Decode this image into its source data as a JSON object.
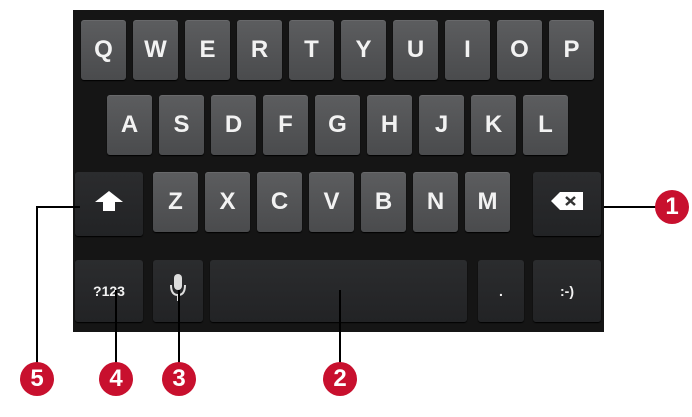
{
  "keyboard": {
    "row1": [
      "Q",
      "W",
      "E",
      "R",
      "T",
      "Y",
      "U",
      "I",
      "O",
      "P"
    ],
    "row2": [
      "A",
      "S",
      "D",
      "F",
      "G",
      "H",
      "J",
      "K",
      "L"
    ],
    "row3": [
      "Z",
      "X",
      "C",
      "V",
      "B",
      "N",
      "M"
    ],
    "bottom": {
      "symbols_label": "?123",
      "period_label": ".",
      "smiley_label": ":-)"
    },
    "icons": {
      "shift": "shift-arrow-icon",
      "delete": "backspace-icon",
      "voice": "microphone-icon"
    }
  },
  "callouts": [
    "1",
    "2",
    "3",
    "4",
    "5"
  ],
  "colors": {
    "callout_badge": "#c8102e",
    "keyboard_background": "#151515",
    "key_face": "#555658"
  }
}
